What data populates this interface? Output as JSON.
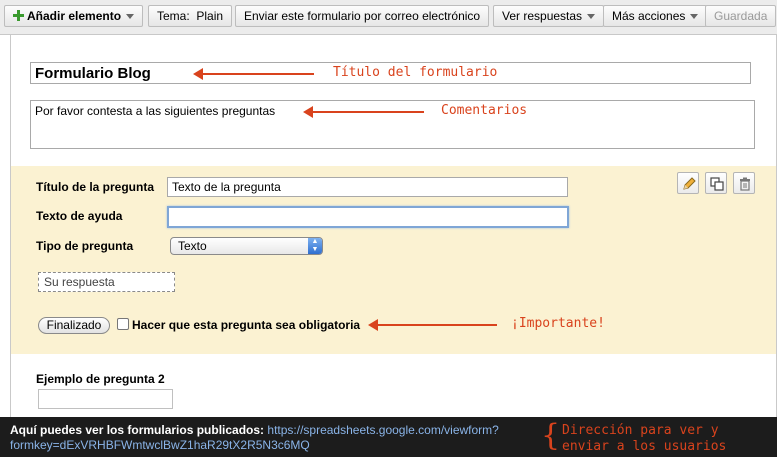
{
  "toolbar": {
    "add_element": "Añadir elemento",
    "theme_label": "Tema:",
    "theme_value": "Plain",
    "email_form": "Enviar este formulario por correo electrónico",
    "view_responses": "Ver respuestas",
    "more_actions": "Más acciones",
    "saved": "Guardada"
  },
  "form": {
    "title": "Formulario Blog",
    "description": "Por favor contesta a las siguientes preguntas"
  },
  "annotations": {
    "title": "Título del formulario",
    "comments": "Comentarios",
    "important": "¡Importante!",
    "footer_line1": "Dirección para ver y",
    "footer_line2": "enviar a los usuarios"
  },
  "question": {
    "title_label": "Título de la pregunta",
    "title_value": "Texto de la pregunta",
    "help_label": "Texto de ayuda",
    "help_value": "",
    "type_label": "Tipo de pregunta",
    "type_value": "Texto",
    "preview_placeholder": "Su respuesta",
    "done_button": "Finalizado",
    "required_label": "Hacer que esta pregunta sea obligatoria"
  },
  "question2": {
    "label": "Ejemplo de pregunta 2"
  },
  "footer": {
    "text": "Aquí puedes ver los formularios publicados:",
    "link_part1": "https://spreadsheets.google.com/viewform?",
    "link_part2": "formkey=dExVRHBFWmtwclBwZ1haR29tX2R5N3c6MQ"
  },
  "colors": {
    "annotation": "#d9431d",
    "panel": "#fbf2d2",
    "footer_bg": "#1c1c1c",
    "link": "#8ab4e8"
  }
}
